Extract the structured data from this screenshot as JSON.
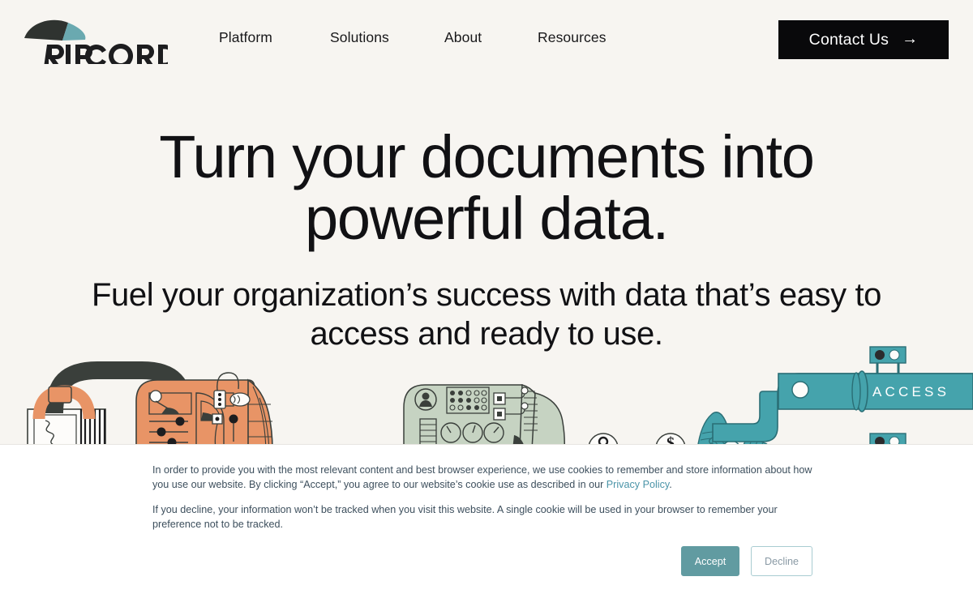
{
  "brand": {
    "name": "RIPCORD",
    "logo_icon": "parachute-canopy-icon",
    "dark_color": "#2f3330",
    "teal_color": "#6aa9b0"
  },
  "header": {
    "nav": [
      {
        "label": "Platform"
      },
      {
        "label": "Solutions"
      },
      {
        "label": "About"
      },
      {
        "label": "Resources"
      }
    ],
    "contact_button": {
      "label": "Contact Us",
      "arrow_icon": "→",
      "background": "#09090b",
      "text_color": "#ffffff"
    }
  },
  "hero": {
    "title": "Turn your documents into powerful data.",
    "subtitle": "Fuel your organization’s success with data that’s easy to access and ready to use."
  },
  "illustration": {
    "pipe_label": "ACCESS",
    "orange_color": "#e89466",
    "sage_color": "#c6d3c2",
    "teal_color": "#45a3ac",
    "dark_color": "#3a3f3b"
  },
  "cookie_banner": {
    "paragraph_1_part_1": "In order to provide you with the most relevant content and best browser experience, we use cookies to remember and store information about how you use our website. By clicking “Accept,” you agree to our website’s cookie use as described in our ",
    "privacy_link": "Privacy Policy",
    "paragraph_1_part_2": ".",
    "paragraph_2": "If you decline, your information won’t be tracked when you visit this website. A single cookie will be used in your browser to remember your preference not to be tracked.",
    "accept_label": "Accept",
    "decline_label": "Decline",
    "accept_color": "#619ba1",
    "link_color": "#4a94a8"
  }
}
